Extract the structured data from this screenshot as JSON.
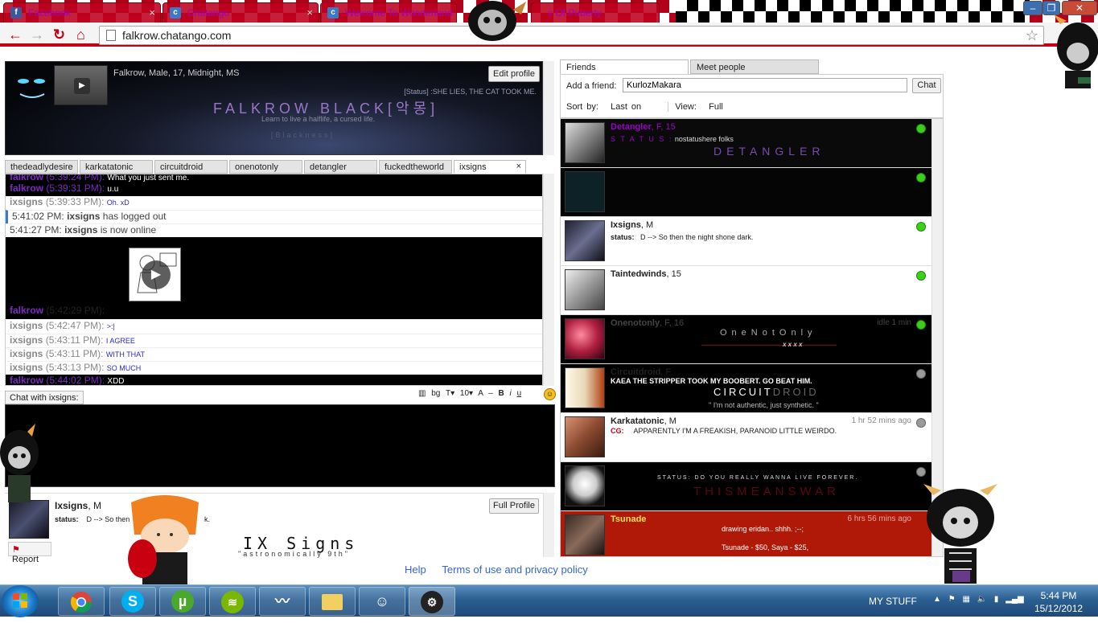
{
  "browser": {
    "tabs": [
      {
        "label": "Facebook",
        "icon": "facebook-icon"
      },
      {
        "label": "Chatango",
        "icon": "chatango-icon"
      },
      {
        "label": "Welcome To Wonderland",
        "icon": "chatango-icon"
      },
      {
        "label": "s Of Puberty",
        "icon": "chatango-icon"
      }
    ],
    "url": "falkrow.chatango.com"
  },
  "profile_banner": {
    "info": "Falkrow, Male, 17, Midnight, MS",
    "edit_button": "Edit profile",
    "status": "[Status] :SHE LIES, THE CAT TOOK ME.",
    "name": "FALKROW BLACK[악몽]",
    "tagline": "Learn to live a halflife, a  cursed life.",
    "sub": "[Blackness]"
  },
  "chat_tabs": [
    "thedeadlydesire",
    "karkatatonic",
    "circuitdroid",
    "onenotonly",
    "detangler",
    "fuckedtheworld",
    "ixsigns"
  ],
  "chat_log": [
    {
      "who": "falkrow",
      "time": "(5:39:24 PM):",
      "text": "What you just sent me.",
      "dark": true
    },
    {
      "who": "falkrow",
      "time": "(5:39:31 PM):",
      "text": "u.u",
      "dark": true
    },
    {
      "who": "ixsigns",
      "time": "(5:39:33 PM):",
      "text": "Oh. xD",
      "dark": false
    },
    {
      "system_time": "5:41:02 PM:",
      "who": "ixsigns",
      "text": "has logged out"
    },
    {
      "system_time": "5:41:27 PM:",
      "who": "ixsigns",
      "text": "is now online"
    },
    {
      "who": "falkrow",
      "time": "(5:42:29 PM):",
      "text": "",
      "dark": true
    },
    {
      "who": "ixsigns",
      "time": "(5:42:47 PM):",
      "text": ">:|",
      "dark": false
    },
    {
      "who": "ixsigns",
      "time": "(5:43:11 PM):",
      "text": "I AGREE",
      "dark": false
    },
    {
      "who": "ixsigns",
      "time": "(5:43:11 PM):",
      "text": "WITH THAT",
      "dark": false
    },
    {
      "who": "ixsigns",
      "time": "(5:43:13 PM):",
      "text": "SO MUCH",
      "dark": false
    },
    {
      "who": "falkrow",
      "time": "(5:44:02 PM):",
      "text": "XDD",
      "dark": true
    }
  ],
  "chat_input": {
    "tab_label": "Chat with ixsigns:",
    "tools": [
      "bg",
      "T",
      "10",
      "B",
      "i",
      "u"
    ]
  },
  "mini_profile": {
    "name": "Ixsigns",
    "meta": ", M",
    "status_label": "status:",
    "status": "D -->  So then",
    "status_tail": "k.",
    "full_profile": "Full Profile",
    "report": "Report",
    "title": "IX Signs",
    "subtitle": "\"astronomically 9th\""
  },
  "footer": {
    "help": "Help",
    "terms": "Terms of use and privacy policy"
  },
  "friends_panel": {
    "tab_friends": "Friends",
    "tab_meet": "Meet people",
    "add_label": "Add a friend:",
    "add_value": "KurlozMakara",
    "chat_button": "Chat",
    "sort_label": "Sort by:",
    "sort_value": "Last on",
    "view_label": "View:",
    "view_value": "Full",
    "friends": [
      {
        "name": "Detangler",
        "meta": ", F, 15",
        "status_label": "S T A T U S :",
        "status": "nostatushere folks",
        "big": "DETANGLER",
        "online": true
      },
      {
        "name": "",
        "meta": "",
        "status": "",
        "big": "",
        "online": true
      },
      {
        "name": "Ixsigns",
        "meta": ", M",
        "status_label": "status:",
        "status": "D -->  So then the night shone dark.",
        "online": true
      },
      {
        "name": "Taintedwinds",
        "meta": ", 15",
        "online": true
      },
      {
        "name": "Onenotonly",
        "meta": ", F, 16",
        "time": "idle 1 min",
        "big": "OneNotOnly",
        "sub": "x x x x",
        "online": true
      },
      {
        "name": "Circuitdroid",
        "meta": ", F",
        "status": "KAEA THE STRIPPER TOOK MY BOOBERT. GO BEAT HIM.",
        "big": "CIRCUIT",
        "big2": "DROID",
        "sub": "\" I'm not authentic, just synthetic. \"",
        "online": false
      },
      {
        "name": "Karkatatonic",
        "meta": ", M",
        "time": "1 hr 52 mins ago",
        "status_label": "CG:",
        "status": "APPARENTLY I'M A FREAKISH, PARANOID LITTLE WEIRDO.",
        "online": false
      },
      {
        "name": "",
        "status": "STATUS: DO YOU REALLY WANNA LIVE FOREVER.",
        "big": "THISMEANSWAR",
        "online": false
      },
      {
        "name": "Tsunade",
        "time": "6 hrs 56 mins ago",
        "status": "drawing eridan.. shhh. ;--;",
        "sub": "Tsunade - $50, Saya - $25,",
        "online": false
      }
    ]
  },
  "taskbar": {
    "mystuff": "MY STUFF",
    "time": "5:44 PM",
    "date": "15/12/2012"
  },
  "colors": {
    "accent": "#c30014",
    "chat_purple": "#7b2ac0",
    "online": "#3ccf1a"
  }
}
